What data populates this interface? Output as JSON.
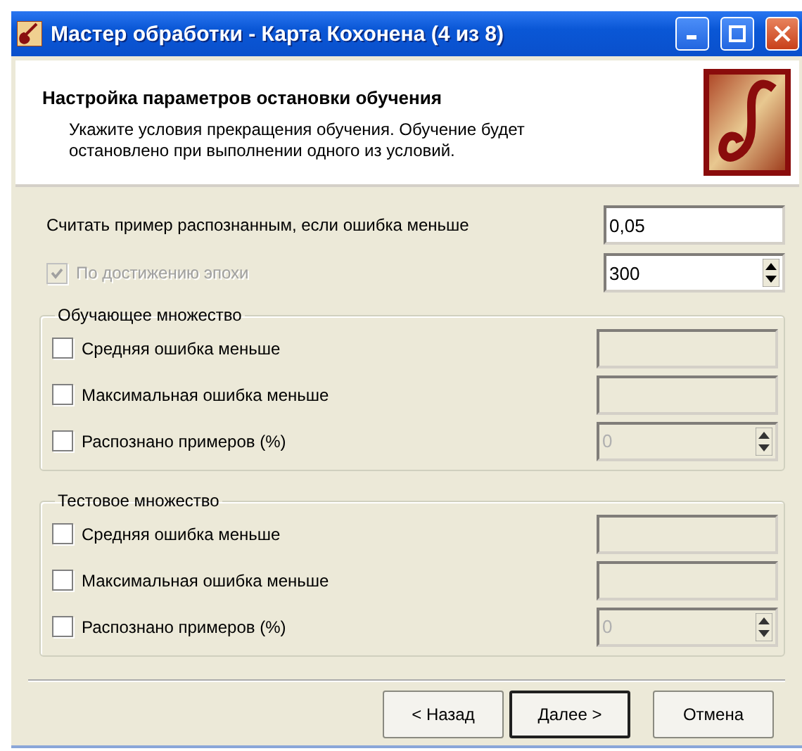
{
  "window": {
    "title": "Мастер обработки - Карта Кохонена (4 из 8)"
  },
  "header": {
    "title": "Настройка параметров остановки обучения",
    "description": [
      "Укажите условия прекращения обучения. Обучение будет",
      "остановлено при выполнении одного из условий."
    ]
  },
  "error_threshold": {
    "label": "Считать пример распознанным, если ошибка меньше",
    "value": "0,05"
  },
  "epoch_limit": {
    "label": "По достижению эпохи",
    "checked": true,
    "disabled": true,
    "value": "300"
  },
  "groups": [
    {
      "title": "Обучающее множество",
      "conditions": [
        {
          "kind": "text",
          "label": "Средняя ошибка меньше",
          "checked": false
        },
        {
          "kind": "text",
          "label": "Максимальная ошибка меньше",
          "checked": false
        },
        {
          "kind": "spin",
          "label": "Распознано примеров (%)",
          "checked": false,
          "value": "0"
        }
      ]
    },
    {
      "title": "Тестовое множество",
      "conditions": [
        {
          "kind": "text",
          "label": "Средняя ошибка меньше",
          "checked": false
        },
        {
          "kind": "text",
          "label": "Максимальная ошибка меньше",
          "checked": false
        },
        {
          "kind": "spin",
          "label": "Распознано примеров (%)",
          "checked": false,
          "value": "0"
        }
      ]
    }
  ],
  "buttons": [
    {
      "label": "< Назад",
      "default": false
    },
    {
      "label": "Далее >",
      "default": true
    },
    {
      "label": "Отмена",
      "default": false
    }
  ]
}
